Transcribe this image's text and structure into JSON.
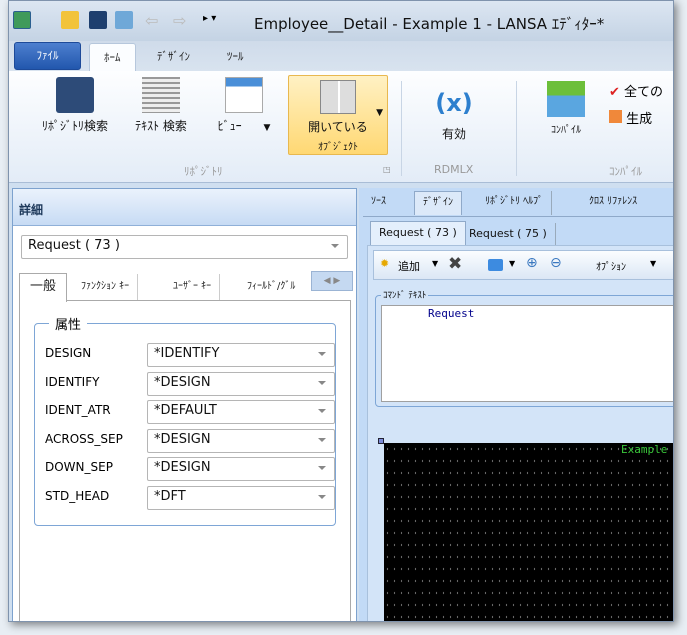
{
  "window": {
    "title": "Employee__Detail - Example 1 - LANSA ｴﾃﾞｨﾀｰ*"
  },
  "ribbon": {
    "tabs": [
      {
        "label": "ﾌｧｲﾙ"
      },
      {
        "label": "ﾎｰﾑ"
      },
      {
        "label": "ﾃﾞｻﾞｲﾝ"
      },
      {
        "label": "ﾂｰﾙ"
      }
    ],
    "buttons": {
      "repo_search": "ﾘﾎﾟｼﾞﾄﾘ検索",
      "text_search": "ﾃｷｽﾄ 検索",
      "view": "ﾋﾞｭｰ",
      "open_objects_1": "開いている",
      "open_objects_2": "ｵﾌﾞｼﾞｪｸﾄ",
      "enable": "有効",
      "compile": "ｺﾝﾊﾟｲﾙ",
      "all": "全ての",
      "generate": "生成"
    },
    "groups": {
      "repository": "ﾘﾎﾟｼﾞﾄﾘ",
      "rdmlx": "RDMLX",
      "compile": "ｺﾝﾊﾟｲﾙ"
    }
  },
  "details": {
    "header": "詳細",
    "selector": "Request ( 73 )",
    "tabs": [
      {
        "label": "一般"
      },
      {
        "label": "ﾌｧﾝｸｼｮﾝ ｷｰ"
      },
      {
        "label": "ﾕｰｻﾞｰ ｷｰ"
      },
      {
        "label": "ﾌｨｰﾙﾄﾞ/ｸﾞﾙ"
      }
    ],
    "group_title": "属性",
    "properties": [
      {
        "name": "DESIGN",
        "value": "*IDENTIFY"
      },
      {
        "name": "IDENTIFY",
        "value": "*DESIGN"
      },
      {
        "name": "IDENT_ATR",
        "value": "*DEFAULT"
      },
      {
        "name": "ACROSS_SEP",
        "value": "*DESIGN"
      },
      {
        "name": "DOWN_SEP",
        "value": "*DESIGN"
      },
      {
        "name": "STD_HEAD",
        "value": "*DFT"
      }
    ]
  },
  "editor": {
    "tabs": [
      {
        "label": "ｿｰｽ"
      },
      {
        "label": "ﾃﾞｻﾞｲﾝ"
      },
      {
        "label": "ﾘﾎﾟｼﾞﾄﾘ ﾍﾙﾌﾟ"
      },
      {
        "label": "ｸﾛｽ ﾘﾌｧﾚﾝｽ"
      }
    ],
    "subtabs": [
      {
        "label": "Request ( 73 )"
      },
      {
        "label": "Request ( 75 )"
      }
    ],
    "toolbar": {
      "add": "追加",
      "options": "ｵﾌﾟｼｮﾝ"
    },
    "command_group": "ｺﾏﾝﾄﾞ ﾃｷｽﾄ",
    "command_text": "Request",
    "screen_text": "Example"
  }
}
